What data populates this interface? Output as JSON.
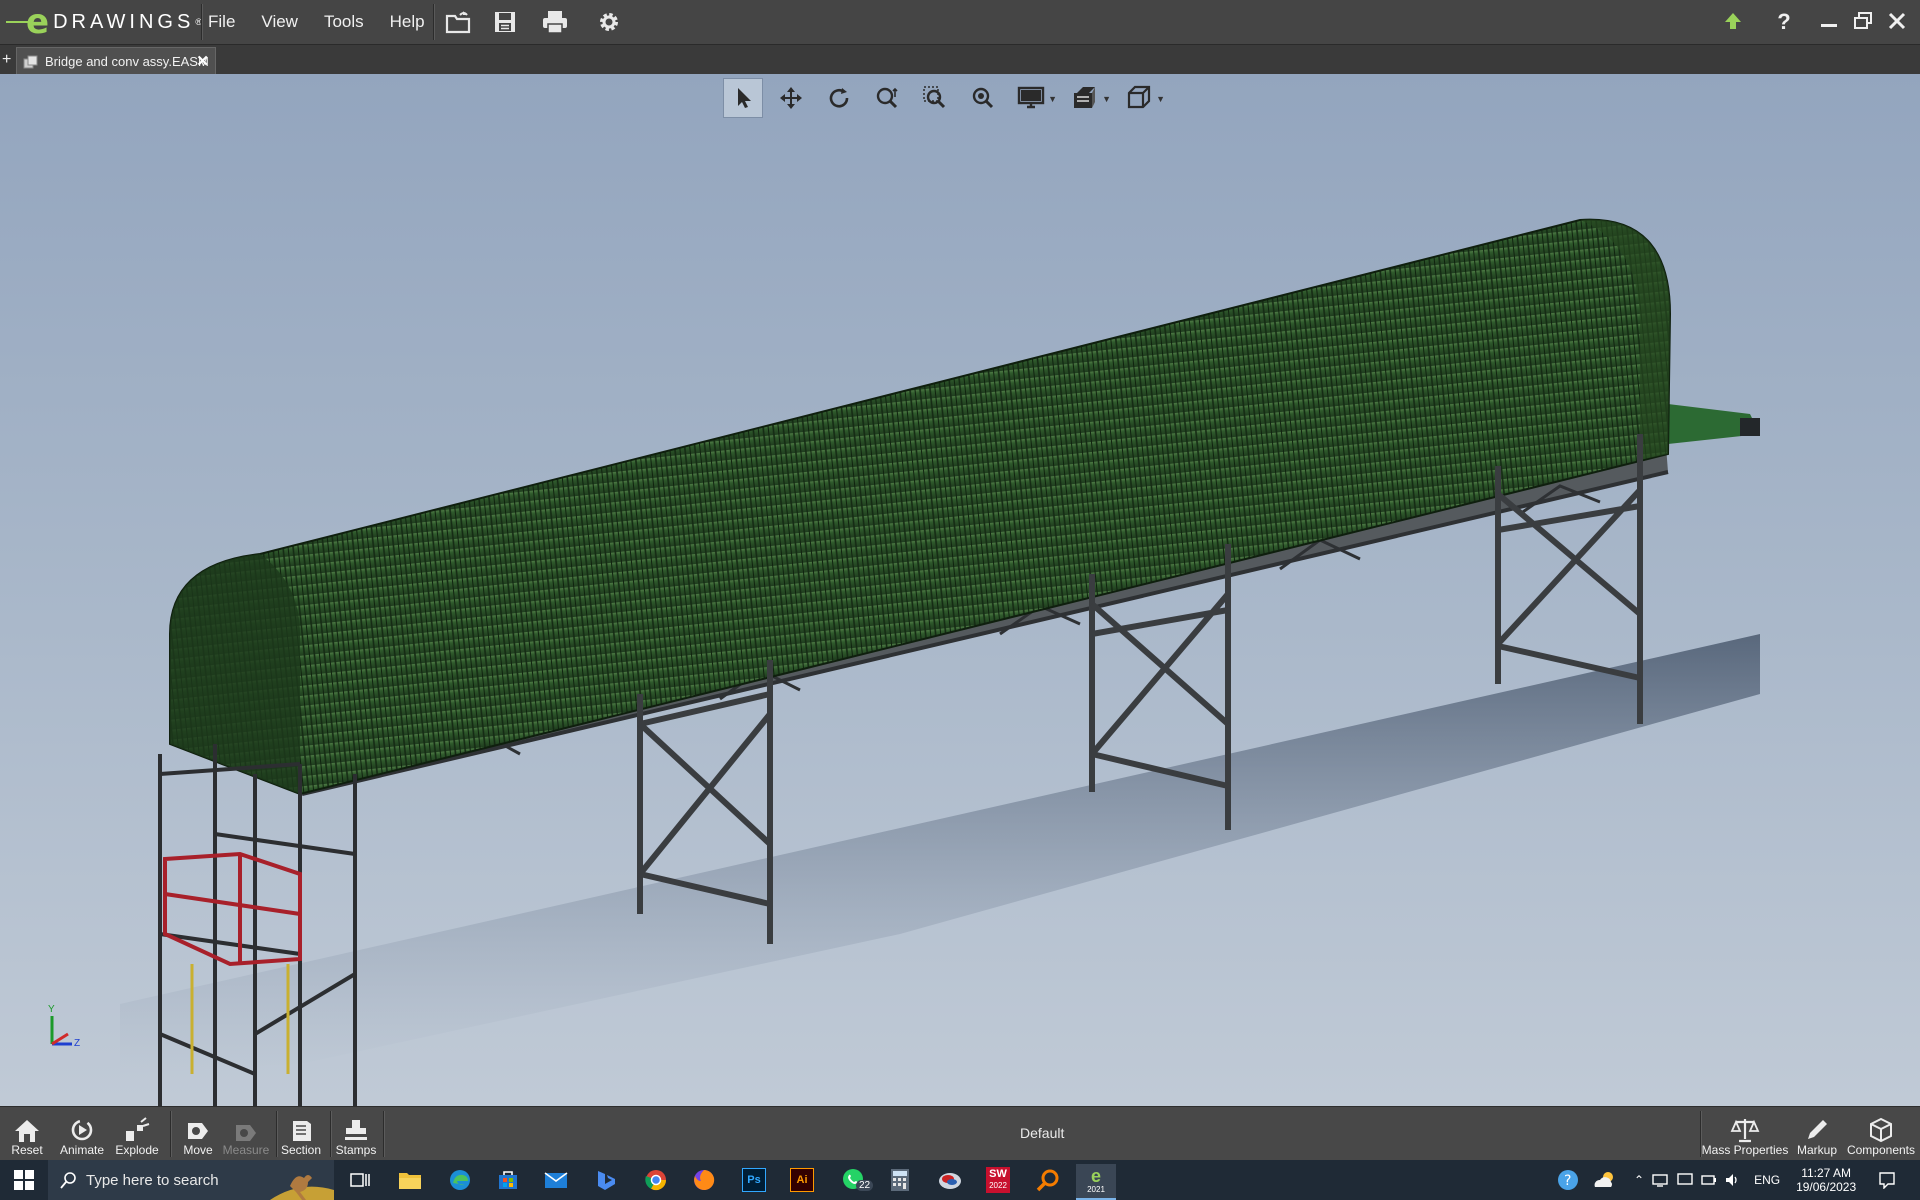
{
  "app": {
    "logo_letter": "e",
    "logo_text": "DRAWINGS",
    "logo_reg": "®"
  },
  "menu": [
    "File",
    "View",
    "Tools",
    "Help"
  ],
  "tab": {
    "title": "Bridge and conv assy.EASM",
    "add_symbol": "+",
    "close_symbol": "✕"
  },
  "window_controls": {
    "help": "?"
  },
  "bottom_toolbar": {
    "left": [
      "Reset",
      "Animate",
      "Explode",
      "Move",
      "Measure",
      "Section",
      "Stamps"
    ],
    "config_label": "Default",
    "right": [
      "Mass Properties",
      "Markup",
      "Components"
    ]
  },
  "taskbar": {
    "search_placeholder": "Type here to search",
    "whatsapp_badge": "22",
    "sw_badge": "2022",
    "edrawings_badge": "2021",
    "language": "ENG",
    "time": "11:27 AM",
    "date": "19/06/2023",
    "sw_label": "SW",
    "ps_label": "Ps",
    "ai_label": "Ai"
  },
  "triad": {
    "y": "Y",
    "z": "Z"
  },
  "colors": {
    "roof_green": "#2f5a2c",
    "steel": "#4d4f52",
    "deck": "#b5ada0",
    "cage_red": "#a8202a",
    "accent_green": "#9ad25a"
  }
}
